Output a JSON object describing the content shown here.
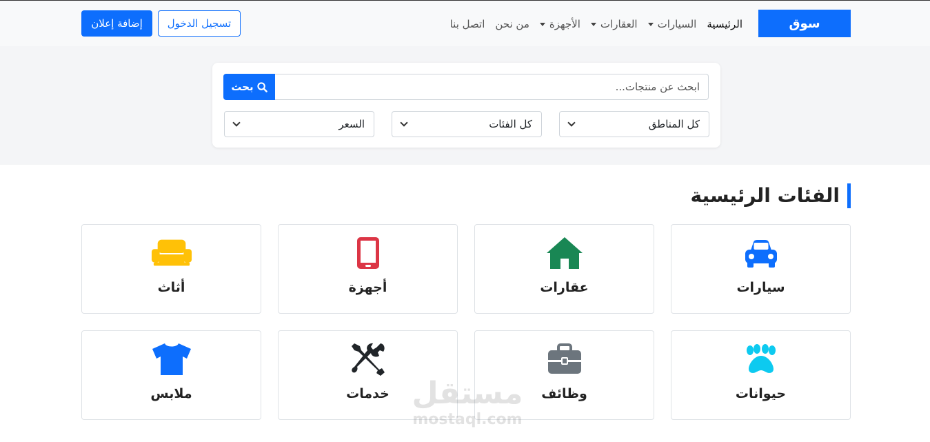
{
  "nav": {
    "brand": "سوق",
    "links": [
      {
        "label": "الرئيسية",
        "dropdown": false
      },
      {
        "label": "السيارات",
        "dropdown": true
      },
      {
        "label": "العقارات",
        "dropdown": true
      },
      {
        "label": "الأجهزة",
        "dropdown": true
      },
      {
        "label": "من نحن",
        "dropdown": false
      },
      {
        "label": "اتصل بنا",
        "dropdown": false
      }
    ],
    "login_label": "تسجيل الدخول",
    "add_ad_label": "إضافة إعلان"
  },
  "search": {
    "placeholder": "ابحث عن منتجات...",
    "button_label": "بحث",
    "regions": "كل المناطق",
    "categories": "كل الفئات",
    "price": "السعر"
  },
  "categories": {
    "title": "الفئات الرئيسية",
    "items": [
      {
        "label": "سيارات",
        "icon": "car-icon",
        "color": "#0d6efd"
      },
      {
        "label": "عقارات",
        "icon": "house-icon",
        "color": "#198754"
      },
      {
        "label": "أجهزة",
        "icon": "phone-icon",
        "color": "#dc3545"
      },
      {
        "label": "أثاث",
        "icon": "couch-icon",
        "color": "#ffc107"
      },
      {
        "label": "حيوانات",
        "icon": "paw-icon",
        "color": "#0dcaf0"
      },
      {
        "label": "وظائف",
        "icon": "briefcase-icon",
        "color": "#6c757d"
      },
      {
        "label": "خدمات",
        "icon": "tools-icon",
        "color": "#212529"
      },
      {
        "label": "ملابس",
        "icon": "shirt-icon",
        "color": "#0d6efd"
      }
    ]
  },
  "watermark": {
    "arabic": "مستقل",
    "latin": "mostaql.com"
  }
}
